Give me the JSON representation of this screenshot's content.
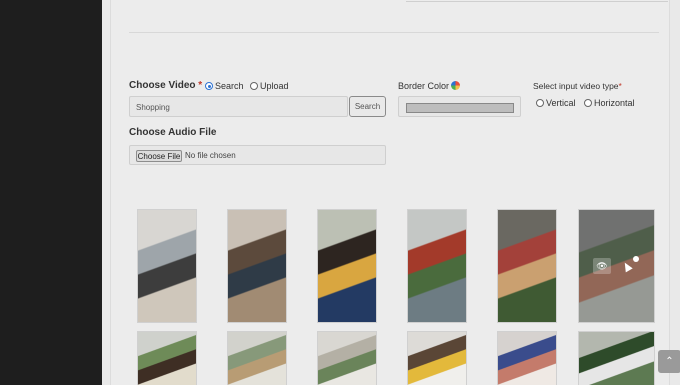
{
  "video": {
    "label": "Choose Video",
    "required": "*",
    "mode_search": "Search",
    "mode_upload": "Upload",
    "search_value": "Shopping",
    "search_button": "Search"
  },
  "border_color": {
    "label": "Border Color",
    "value": "#bdbdbd"
  },
  "video_type": {
    "label": "Select input video type",
    "required": "*",
    "vertical": "Vertical",
    "horizontal": "Horizontal"
  },
  "audio": {
    "label": "Choose Audio File",
    "button": "Choose File",
    "status": "No file chosen"
  },
  "thumbnails": [
    {
      "name": "laptop-shopping",
      "colors": [
        "#d8d6d2",
        "#9ea5aa",
        "#3d3d3d",
        "#cfc7bb"
      ]
    },
    {
      "name": "couple-unboxing",
      "colors": [
        "#c9c0b5",
        "#5c4a3c",
        "#2f3b47",
        "#a18b73"
      ]
    },
    {
      "name": "mother-child",
      "colors": [
        "#bcc0b4",
        "#2d2520",
        "#d9a640",
        "#233a63"
      ]
    },
    {
      "name": "market-flowers",
      "colors": [
        "#c4c7c5",
        "#a33a2a",
        "#4a6b3d",
        "#6d7c83"
      ]
    },
    {
      "name": "market-stall",
      "colors": [
        "#6a6861",
        "#a3413a",
        "#caa070",
        "#3f5a33"
      ]
    },
    {
      "name": "plant-shop",
      "colors": [
        "#8a8d8a",
        "#4f6a45",
        "#c97a5d",
        "#cfd6cd"
      ]
    },
    {
      "name": "plant-shelf",
      "colors": [
        "#cfd1cc",
        "#6e8b58",
        "#3e2e24",
        "#e2dccc"
      ]
    },
    {
      "name": "room-interior",
      "colors": [
        "#d2d2cc",
        "#87997a",
        "#b89c74",
        "#e4e2da"
      ]
    },
    {
      "name": "shelf-decor",
      "colors": [
        "#d9d7d2",
        "#b4b0a5",
        "#6a845a",
        "#e9e7e2"
      ]
    },
    {
      "name": "man-portrait",
      "colors": [
        "#dddbd7",
        "#5a4636",
        "#e3b93b",
        "#f0efec"
      ]
    },
    {
      "name": "clothes-rack",
      "colors": [
        "#d6d2cf",
        "#3a4c8c",
        "#c47b6b",
        "#efe9e4"
      ]
    },
    {
      "name": "plant-store",
      "colors": [
        "#b3b7ae",
        "#2e4b2a",
        "#e6e6e6",
        "#5d7a52"
      ]
    }
  ],
  "scroll_top_icon": "chevron-up-icon"
}
